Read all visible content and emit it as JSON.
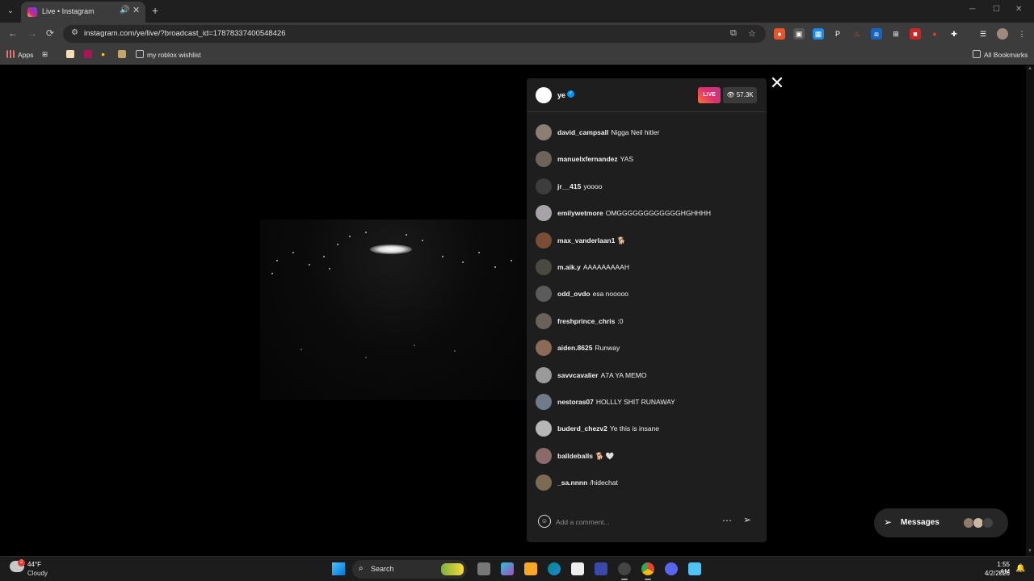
{
  "browser": {
    "tab": {
      "title": "Live • Instagram"
    },
    "url": "instagram.com/ye/live/?broadcast_id=17878337400548426",
    "bookmarks": [
      {
        "label": "Apps"
      },
      {
        "label": "my roblox wishlist"
      }
    ],
    "all_bookmarks_label": "All Bookmarks"
  },
  "live": {
    "host": {
      "username": "ye",
      "verified": true
    },
    "live_badge": "LIVE",
    "viewer_count": "57.3K",
    "comments": [
      {
        "user": "david_campsall",
        "text": "Nigga Neil hitler",
        "color": "#8a7f72"
      },
      {
        "user": "manuelxfernandez",
        "text": "YAS",
        "color": "#6d6459"
      },
      {
        "user": "jr__415",
        "text": "yoooo",
        "color": "#3d3d3d"
      },
      {
        "user": "emilywetmore",
        "text": "OMGGGGGGGGGGGGHGHHHH",
        "color": "#a7a3a8"
      },
      {
        "user": "max_vanderlaan1",
        "text": "🐕",
        "color": "#7a4e35"
      },
      {
        "user": "m.aik.y",
        "text": "AAAAAAAAAH",
        "color": "#4a4a42"
      },
      {
        "user": "odd_ovdo",
        "text": "esa nooooo",
        "color": "#5b5b5b"
      },
      {
        "user": "freshprince_chris",
        "text": ":0",
        "color": "#6a6158"
      },
      {
        "user": "aiden.8625",
        "text": "Runway",
        "color": "#8b6a58"
      },
      {
        "user": "savvcavalier",
        "text": "A7A YA MEMO",
        "color": "#9a9a9a"
      },
      {
        "user": "nestoras07",
        "text": "HOLLLY SHIT RUNAWAY",
        "color": "#6f7a8a"
      },
      {
        "user": "buderd_chezv2",
        "text": "Ye this is insane",
        "color": "#b7b7b7"
      },
      {
        "user": "balldeballs",
        "text": "🐕 🤍",
        "color": "#8a6a6a"
      },
      {
        "user": "_sa.nnnn",
        "text": "/hidechat",
        "color": "#7d6a55"
      }
    ],
    "comment_placeholder": "Add a comment..."
  },
  "messages": {
    "label": "Messages"
  },
  "taskbar": {
    "weather": {
      "temp": "44°F",
      "condition": "Cloudy",
      "badge": "2"
    },
    "search_label": "Search",
    "time": "1:55 AM",
    "date": "4/2/2026"
  }
}
